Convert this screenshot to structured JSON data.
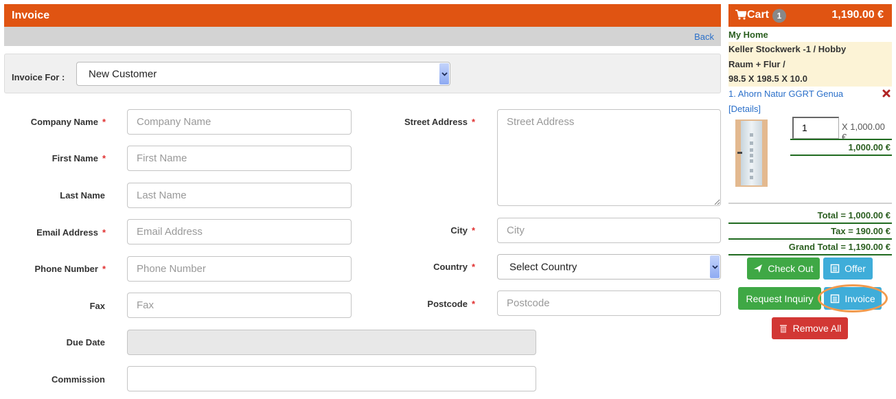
{
  "header": {
    "title": "Invoice",
    "back_link": "Back"
  },
  "invoice_for": {
    "label": "Invoice For :",
    "selected": "New Customer"
  },
  "form": {
    "company_name": {
      "label": "Company Name",
      "required": "*",
      "placeholder": "Company Name",
      "value": ""
    },
    "first_name": {
      "label": "First Name",
      "required": "*",
      "placeholder": "First Name",
      "value": ""
    },
    "last_name": {
      "label": "Last Name",
      "placeholder": "Last Name",
      "value": ""
    },
    "email": {
      "label": "Email Address",
      "required": "*",
      "placeholder": "Email Address",
      "value": ""
    },
    "phone": {
      "label": "Phone Number",
      "required": "*",
      "placeholder": "Phone Number",
      "value": ""
    },
    "fax": {
      "label": "Fax",
      "placeholder": "Fax",
      "value": ""
    },
    "due_date": {
      "label": "Due Date",
      "value": ""
    },
    "commission": {
      "label": "Commission",
      "value": ""
    },
    "street_address": {
      "label": "Street Address",
      "required": "*",
      "placeholder": "Street Address",
      "value": ""
    },
    "city": {
      "label": "City",
      "required": "*",
      "placeholder": "City",
      "value": ""
    },
    "country": {
      "label": "Country",
      "required": "*",
      "selected": "Select Country"
    },
    "postcode": {
      "label": "Postcode",
      "required": "*",
      "placeholder": "Postcode",
      "value": ""
    }
  },
  "cart": {
    "label": "Cart",
    "count": "1",
    "header_total": "1,190.00 €",
    "home": "My Home",
    "room_line1": "Keller Stockwerk -1 / Hobby",
    "room_line2": "Raum + Flur /",
    "dimensions": "98.5 X 198.5 X 10.0",
    "items": [
      {
        "name": "1. Ahorn Natur GGRT Genua",
        "details_link": "[Details]",
        "quantity": "1",
        "unit_price": "X 1,000.00 €",
        "line_total": "1,000.00 €"
      }
    ],
    "total": "Total = 1,000.00 €",
    "tax": "Tax = 190.00 €",
    "grand_total": "Grand Total = 1,190.00 €",
    "buttons": {
      "checkout": "Check Out",
      "offer": "Offer",
      "request_inquiry": "Request Inquiry",
      "invoice": "Invoice",
      "remove_all": "Remove All"
    }
  },
  "colors": {
    "brand_orange": "#e05412",
    "total_green": "#2a5e1f",
    "button_green": "#3fa845",
    "button_blue": "#3fadd9",
    "button_red": "#d23734",
    "highlight": "#f29a4d"
  }
}
